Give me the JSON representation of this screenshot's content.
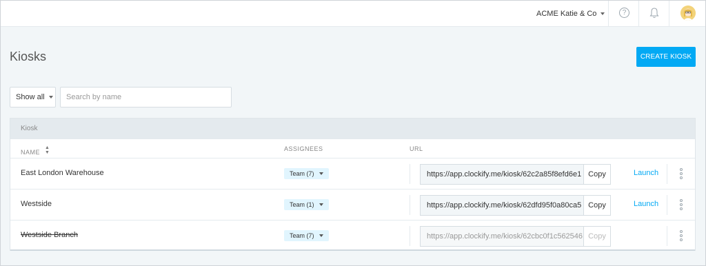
{
  "header": {
    "workspace": "ACME Katie & Co",
    "help_icon": "?",
    "icons": [
      "help-icon",
      "bell-icon",
      "avatar"
    ]
  },
  "page": {
    "title": "Kiosks",
    "create_button": "CREATE KIOSK"
  },
  "filters": {
    "show": "Show all",
    "search_placeholder": "Search by name"
  },
  "table": {
    "caption": "Kiosk",
    "columns": {
      "name": "NAME",
      "assignees": "ASSIGNEES",
      "url": "URL"
    },
    "rows": [
      {
        "name": "East London Warehouse",
        "assignees": "Team (7)",
        "url": "https://app.clockify.me/kiosk/62c2a85f8efd6e1",
        "copy": "Copy",
        "launch": "Launch",
        "archived": false
      },
      {
        "name": "Westside",
        "assignees": "Team (1)",
        "url": "https://app.clockify.me/kiosk/62dfd95f0a80ca5",
        "copy": "Copy",
        "launch": "Launch",
        "archived": false
      },
      {
        "name": "Westside Branch",
        "assignees": "Team (7)",
        "url": "https://app.clockify.me/kiosk/62cbc0f1c562546",
        "copy": "Copy",
        "launch": "",
        "archived": true
      }
    ]
  },
  "colors": {
    "accent": "#03a9f4",
    "badge_bg": "#e1f5fe",
    "page_bg": "#f2f6f8"
  }
}
